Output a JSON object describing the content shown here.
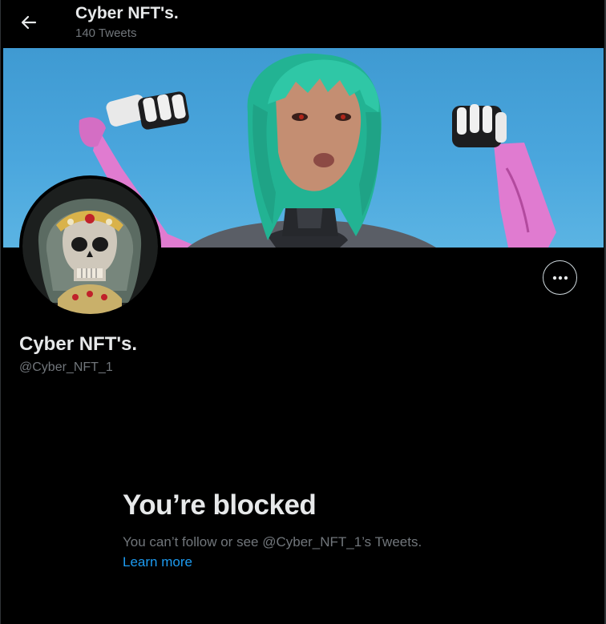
{
  "header": {
    "title": "Cyber NFT's.",
    "subtitle": "140 Tweets"
  },
  "profile": {
    "name": "Cyber NFT's.",
    "handle": "@Cyber_NFT_1"
  },
  "blocked": {
    "title": "You’re blocked",
    "description": "You can’t follow or see @Cyber_NFT_1’s Tweets.",
    "link": "Learn more"
  },
  "icons": {
    "back": "back-arrow-icon",
    "more": "more-options-icon"
  },
  "colors": {
    "background": "#000000",
    "text_primary": "#e7e9ea",
    "text_secondary": "#71767b",
    "link": "#1d9bf0",
    "banner_sky": "#4aa6dd",
    "hair": "#2fc7a6",
    "arm_pink": "#e07bd0"
  }
}
